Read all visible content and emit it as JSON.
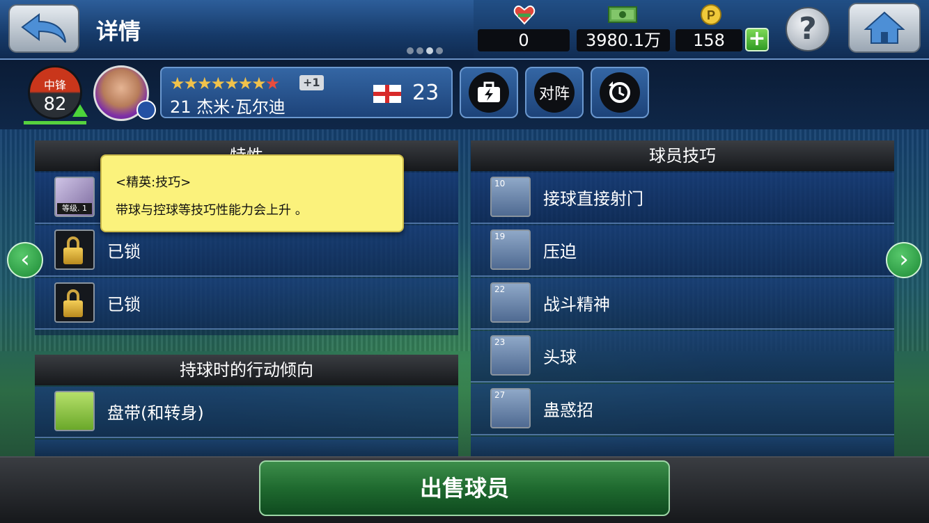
{
  "header": {
    "title": "详情",
    "resources": {
      "heart_value": "0",
      "money_value": "3980.1万",
      "coin_value": "158"
    }
  },
  "player": {
    "position": "中锋",
    "rating": "82",
    "stars_gold": "★★★★★★★",
    "stars_red": "★",
    "star_bonus": "+1",
    "name": "21 杰米·瓦尔迪",
    "age": "23"
  },
  "buttons": {
    "lineup": "对阵",
    "sell": "出售球员"
  },
  "traits_panel": {
    "title": "特性",
    "items": [
      {
        "label": "",
        "level": "等级. 1"
      },
      {
        "label": "已锁"
      },
      {
        "label": "已锁"
      }
    ]
  },
  "tooltip": {
    "title": "<精英:技巧>",
    "body": "带球与控球等技巧性能力会上升 。"
  },
  "tendency_panel": {
    "title": "持球时的行动倾向",
    "items": [
      {
        "label": "盘带(和转身)"
      }
    ]
  },
  "skills_panel": {
    "title": "球员技巧",
    "items": [
      {
        "num": "10",
        "label": "接球直接射门"
      },
      {
        "num": "19",
        "label": "压迫"
      },
      {
        "num": "22",
        "label": "战斗精神"
      },
      {
        "num": "23",
        "label": "头球"
      },
      {
        "num": "27",
        "label": "蛊惑招"
      }
    ]
  },
  "colors": {
    "accent_green": "#2f9a24",
    "tooltip_yellow": "#fbf27c",
    "position_red": "#c9361b"
  }
}
